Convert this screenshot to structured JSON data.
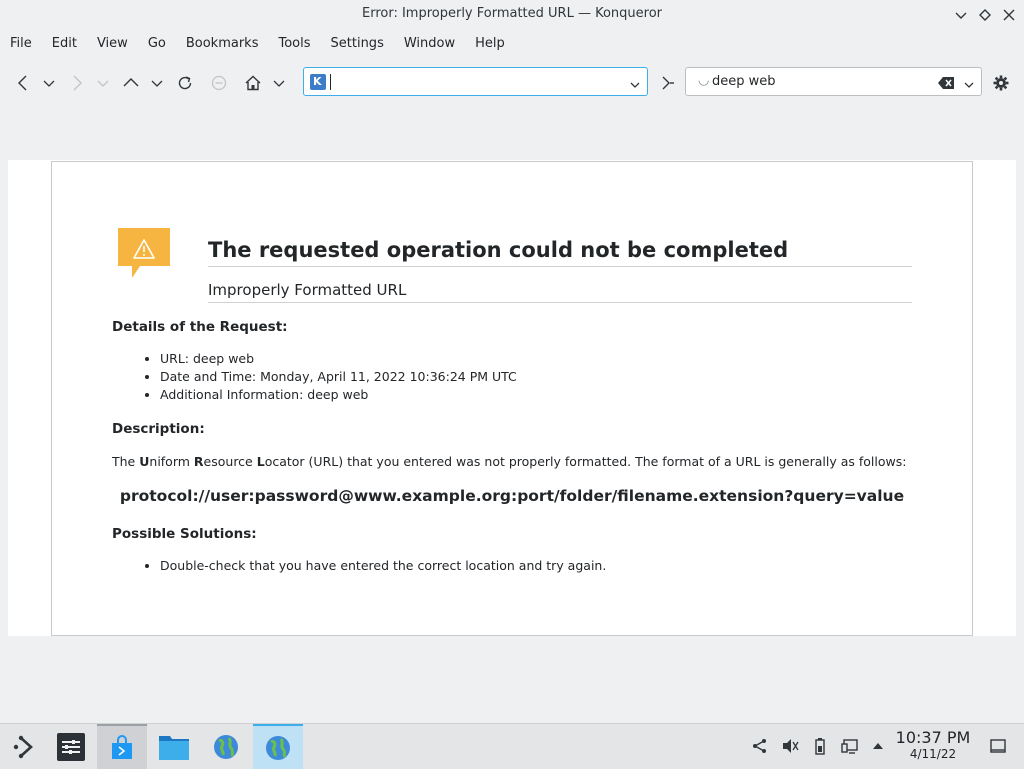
{
  "window": {
    "title": "Error: Improperly Formatted URL — Konqueror"
  },
  "menu": [
    "File",
    "Edit",
    "View",
    "Go",
    "Bookmarks",
    "Tools",
    "Settings",
    "Window",
    "Help"
  ],
  "toolbar": {
    "url_value": "",
    "search_value": "deep web"
  },
  "page": {
    "heading": "The requested operation could not be completed",
    "subheading": "Improperly Formatted URL",
    "details_title": "Details of the Request:",
    "details": [
      "URL: deep web",
      "Date and Time: Monday, April 11, 2022 10:36:24 PM UTC",
      "Additional Information: deep web"
    ],
    "description_title": "Description:",
    "description": {
      "p1": "The ",
      "u": "U",
      "p2": "niform ",
      "r": "R",
      "p3": "esource ",
      "l": "L",
      "p4": "ocator (URL) that you entered was not properly formatted. The format of a URL is generally as follows:"
    },
    "example": "protocol://user:password@www.example.org:port/folder/filename.extension?query=value",
    "solutions_title": "Possible Solutions:",
    "solutions": [
      "Double-check that you have entered the correct location and try again."
    ]
  },
  "taskbar": {
    "time": "10:37 PM",
    "date": "4/11/22"
  },
  "colors": {
    "accent": "#3daee9",
    "warning": "#f5b540"
  }
}
